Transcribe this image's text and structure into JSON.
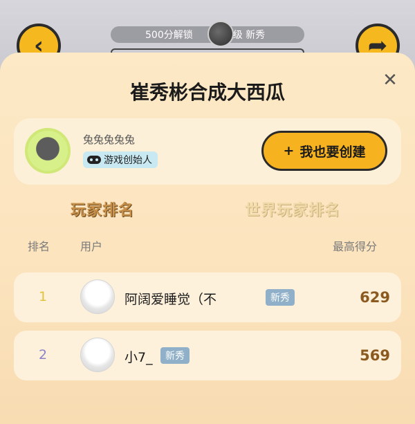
{
  "background": {
    "unlock_pill_left": "500分解锁",
    "unlock_pill_right": "级 新秀",
    "back_icon": "chevron-left",
    "share_icon": "share-arrow"
  },
  "title": "崔秀彬合成大西瓜",
  "close_icon": "close-x",
  "creator": {
    "name": "兔兔兔兔兔",
    "badge": "游戏创始人",
    "badge_icon": "gamepad"
  },
  "create_button": {
    "icon": "+",
    "label": "我也要创建"
  },
  "tabs": {
    "active": "玩家排名",
    "inactive": "世界玩家排名"
  },
  "columns": {
    "rank": "排名",
    "user": "用户",
    "score": "最高得分"
  },
  "rows": [
    {
      "rank": "1",
      "name": "阿阔爱睡觉（不",
      "badge": "新秀",
      "score": "629",
      "rank_color": "#e2c23a"
    },
    {
      "rank": "2",
      "name": "小7_",
      "badge": "新秀",
      "score": "569",
      "rank_color": "#8a82c8"
    }
  ],
  "colors": {
    "accent": "#f7b21f",
    "score": "#8b5a1e",
    "badge": "#8fb0c8"
  }
}
